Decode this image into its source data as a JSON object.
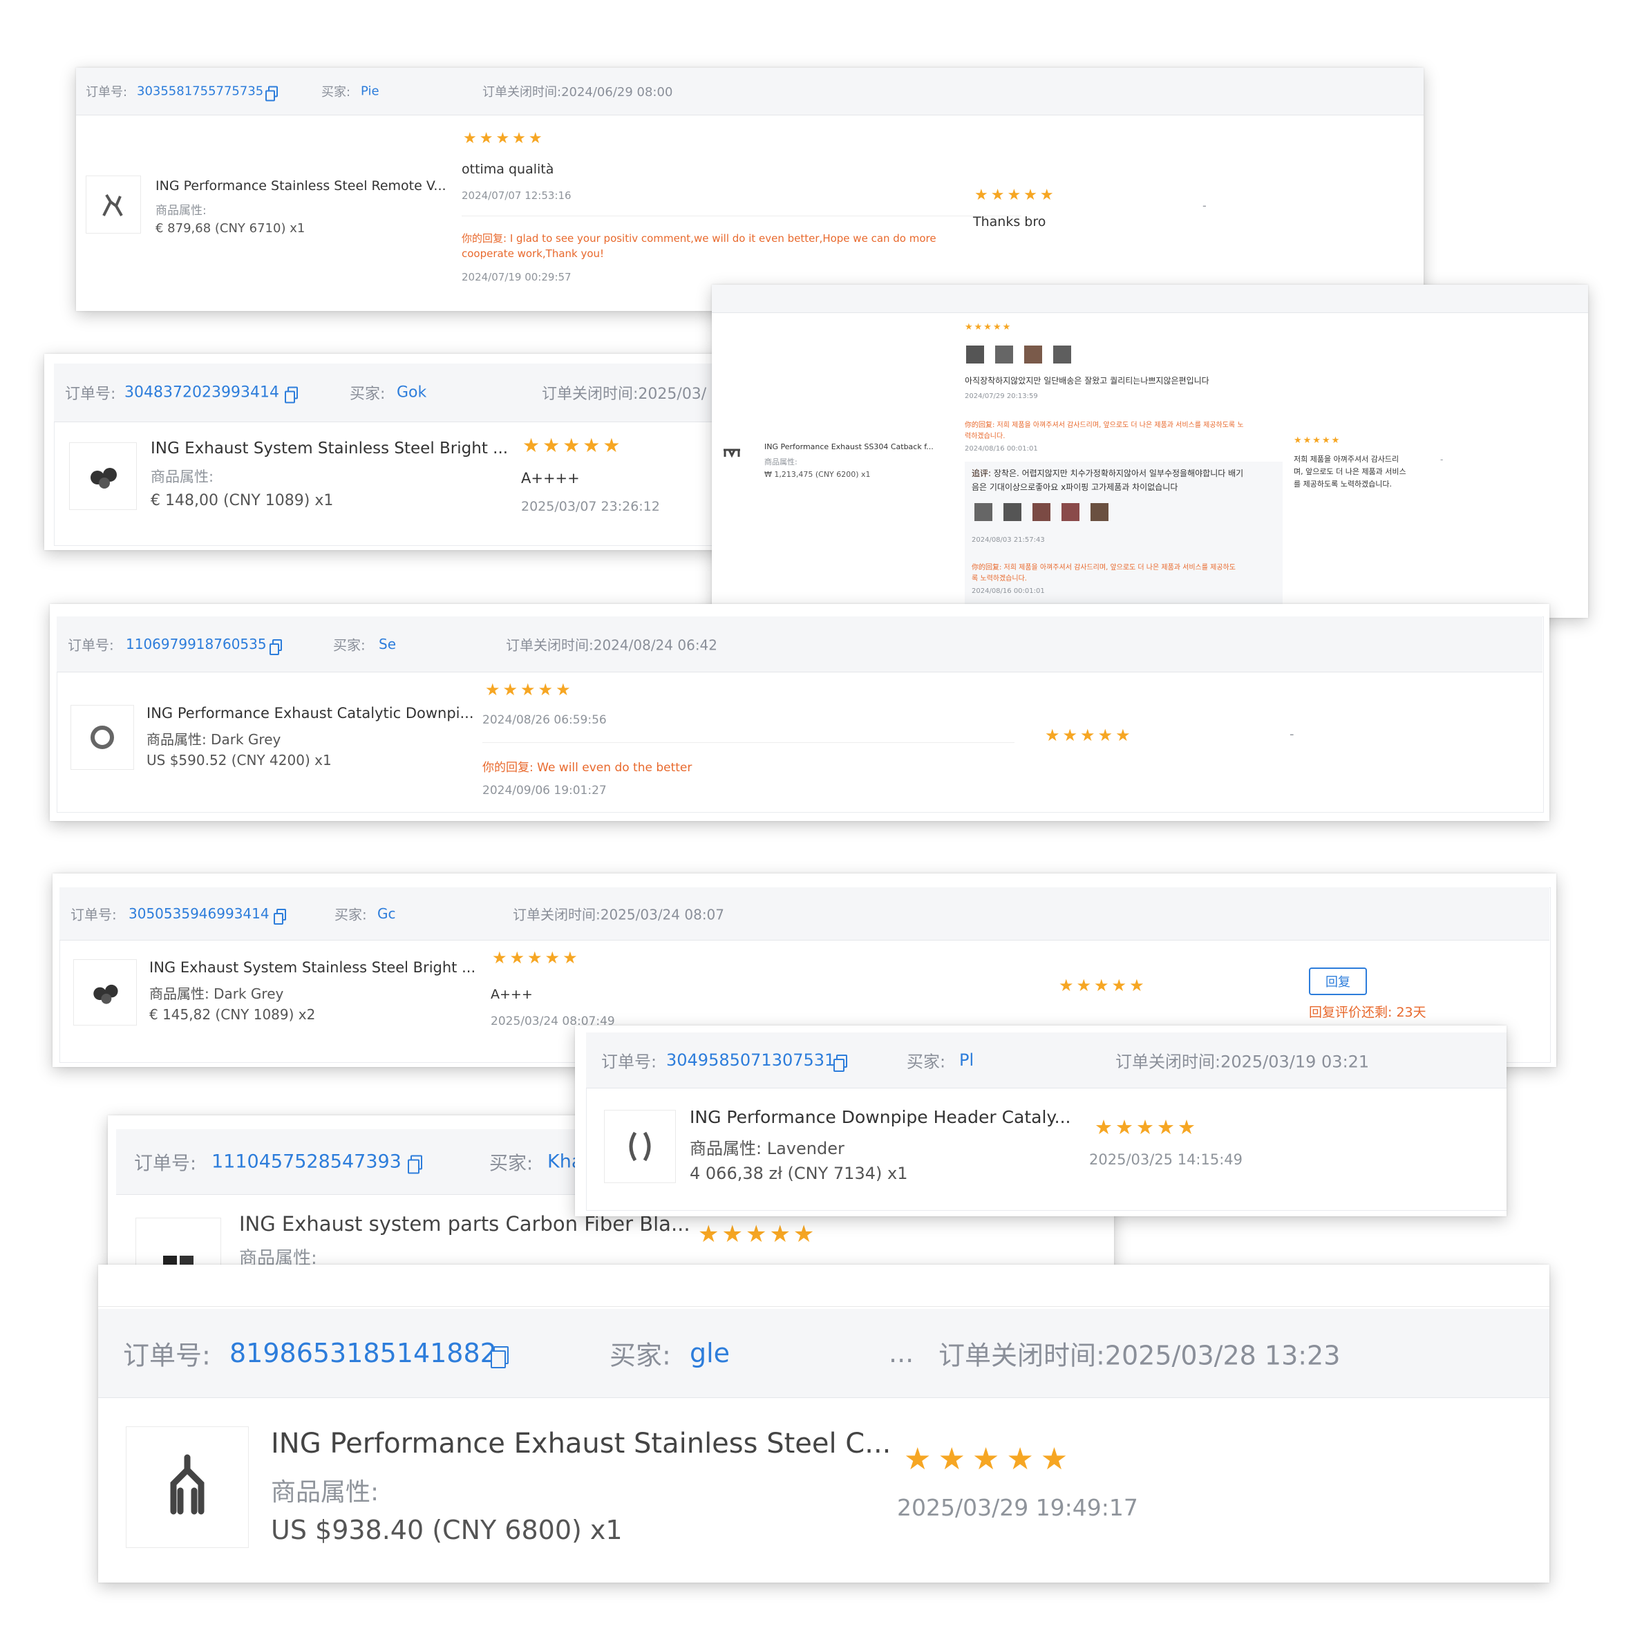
{
  "colors": {
    "link": "#2d7ddb",
    "star": "#f6a623",
    "reply": "#e8692d",
    "header_bg": "#f5f6f8"
  },
  "labels": {
    "order_no": "订单号:",
    "buyer": "买家:",
    "attr": "商品属性:",
    "your_reply": "你的回复:",
    "append": "追评:"
  },
  "card1": {
    "order_no": "3035581755775735",
    "buyer": "Pie",
    "closed": "订单关闭时间:2024/06/29 08:00",
    "product": "ING Performance Stainless Steel Remote V...",
    "attr": "商品属性:",
    "price": "€ 879,68  (CNY  6710)  x1",
    "stars": "★★★★★",
    "review": "ottima qualità",
    "review_time": "2024/07/07 12:53:16",
    "reply": "你的回复: I glad to see your positiv comment,we will do it even better,Hope we can do more",
    "reply2": "cooperate work,Thank you!",
    "reply_time": "2024/07/19 00:29:57",
    "seller_stars": "★★★★★",
    "seller_review": "Thanks bro",
    "dash": "-"
  },
  "card2": {
    "order_no": "3048372023993414",
    "buyer": "Gok",
    "closed": "订单关闭时间:2025/03/",
    "product": "ING Exhaust System Stainless Steel Bright ...",
    "attr": "商品属性:",
    "price": "€ 148,00  (CNY  1089)  x1",
    "stars": "★★★★★",
    "review": "A++++",
    "review_time": "2025/03/07 23:26:12"
  },
  "card_kr": {
    "product": "ING Performance Exhaust SS304 Catback f...",
    "attr": "商品属性:",
    "price": "₩ 1,213,475  (CNY  6200)  x1",
    "stars": "★★★★★",
    "review": "아직장착하지않았지만 일단배송은 잘왔고 퀄리티는나쁘지않은편입니다",
    "review_time": "2024/07/29 20:13:59",
    "reply": "你的回复: 저희 제품을 아껴주셔서 감사드리며, 앞으로도 더 나은 제품과 서비스를 제공하도록 노",
    "reply2": "력하겠습니다.",
    "reply_time": "2024/08/16 00:01:01",
    "append": "追评: 장착은. 어렵지않지만 치수가정확하지않아서 일부수정을해야합니다 배기",
    "append2": "음은 기대이상으로좋아요 x파이핑 고가제품과 차이없습니다",
    "append_time": "2024/08/03 21:57:43",
    "reply_b": "你的回复: 저희 제품을 아껴주셔서 감사드리며, 앞으로도 더 나은 제품과 서비스를 제공하도",
    "reply_b2": "록 노력하겠습니다.",
    "reply_b_time": "2024/08/16 00:01:01",
    "seller_stars": "★★★★★",
    "seller_review1": "저희 제품을 아껴주셔서 감사드리",
    "seller_review2": "며, 앞으로도 더 나은 제품과 서비스",
    "seller_review3": "를 제공하도록 노력하겠습니다.",
    "dash": "-"
  },
  "card3": {
    "order_no": "1106979918760535",
    "buyer": "Se",
    "closed": "订单关闭时间:2024/08/24 06:42",
    "product": "ING Performance Exhaust Catalytic Downpi...",
    "attr": "商品属性: Dark Grey",
    "price": "US $590.52  (CNY  4200)  x1",
    "stars": "★★★★★",
    "review_time": "2024/08/26 06:59:56",
    "reply": "你的回复: We will even do the better",
    "reply_time": "2024/09/06 19:01:27",
    "seller_stars": "★★★★★",
    "dash": "-"
  },
  "card4": {
    "order_no": "3050535946993414",
    "buyer": "Gc",
    "closed": "订单关闭时间:2025/03/24 08:07",
    "product": "ING Exhaust System Stainless Steel Bright ...",
    "attr": "商品属性: Dark Grey",
    "price": "€ 145,82  (CNY  1089)  x2",
    "stars": "★★★★★",
    "review": "A+++",
    "review_time": "2025/03/24 08:07:49",
    "seller_stars": "★★★★★",
    "reply_button": "回复",
    "remaining": "回复评价还剩: 23天"
  },
  "card5": {
    "order_no": "3049585071307531",
    "buyer": "Pl",
    "closed": "订单关闭时间:2025/03/19 03:21",
    "product": "ING Performance Downpipe Header Cataly...",
    "attr": "商品属性: Lavender",
    "price": "4 066,38 zł  (CNY  7134)  x1",
    "stars": "★★★★★",
    "review_time": "2025/03/25 14:15:49"
  },
  "card6": {
    "order_no": "1110457528547393",
    "buyer": "Kha",
    "product": "ING Exhaust system parts Carbon Fiber Bla...",
    "attr": "商品属性:",
    "stars": "★★★★★"
  },
  "card7": {
    "order_no": "8198653185141882",
    "buyer": "gle",
    "ellipsis": "...",
    "closed": "订单关闭时间:2025/03/28 13:23",
    "product": "ING Performance Exhaust Stainless Steel C...",
    "attr": "商品属性:",
    "price": "US $938.40  (CNY  6800)  x1",
    "stars": "★★★★★",
    "review_time": "2025/03/29 19:49:17"
  }
}
